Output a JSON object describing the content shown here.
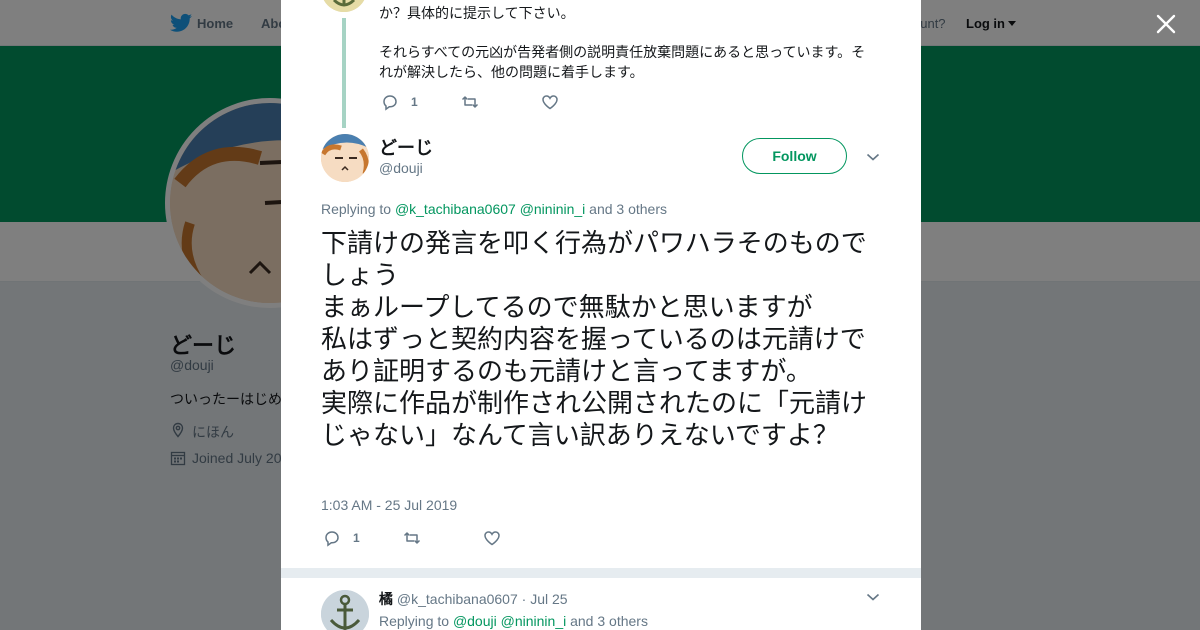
{
  "nav": {
    "home_label": "Home",
    "about_label": "Abo",
    "account_prompt": "ccount?",
    "login_label": "Log in"
  },
  "profile": {
    "name": "どーじ",
    "handle": "@douji",
    "bio": "ついったーはじめ",
    "location": "にほん",
    "joined": "Joined July 20"
  },
  "previous_tweet": {
    "line1": "か？具体的に提示して下さい。",
    "line2": "それらすべての元凶が告発者側の説明責任放棄問題にあると思っています。それが解決したら、他の問題に着手します。",
    "reply_count": "1"
  },
  "main_tweet": {
    "name": "どーじ",
    "handle": "@douji",
    "follow_label": "Follow",
    "replying_prefix": "Replying to",
    "replying_user1": "@k_tachibana0607",
    "replying_user2": "@nininin_i",
    "replying_suffix": "and 3 others",
    "text": "下請けの発言を叩く行為がパワハラそのものでしょう\nまぁループしてるので無駄かと思いますが\n私はずっと契約内容を握っているのは元請けであり証明するのも元請けと言ってますが。\n実際に作品が制作され公開されたのに「元請けじゃない」なんて言い訳ありえないですよ？",
    "timestamp": "1:03 AM - 25 Jul 2019",
    "reply_count": "1"
  },
  "reply_tweet": {
    "name": "橘",
    "handle": "@k_tachibana0607",
    "separator": "·",
    "date": "Jul 25",
    "replying_prefix": "Replying to",
    "replying_user1": "@douji",
    "replying_user2": "@nininin_i",
    "replying_suffix": "and 3 others"
  },
  "colors": {
    "accent": "#03965f",
    "banner": "#03965f",
    "text": "#14171a",
    "muted": "#657786"
  },
  "icons": [
    "twitter-bird-icon",
    "close-icon",
    "reply-icon",
    "retweet-icon",
    "like-icon",
    "chevron-down-icon",
    "location-icon",
    "calendar-icon"
  ]
}
